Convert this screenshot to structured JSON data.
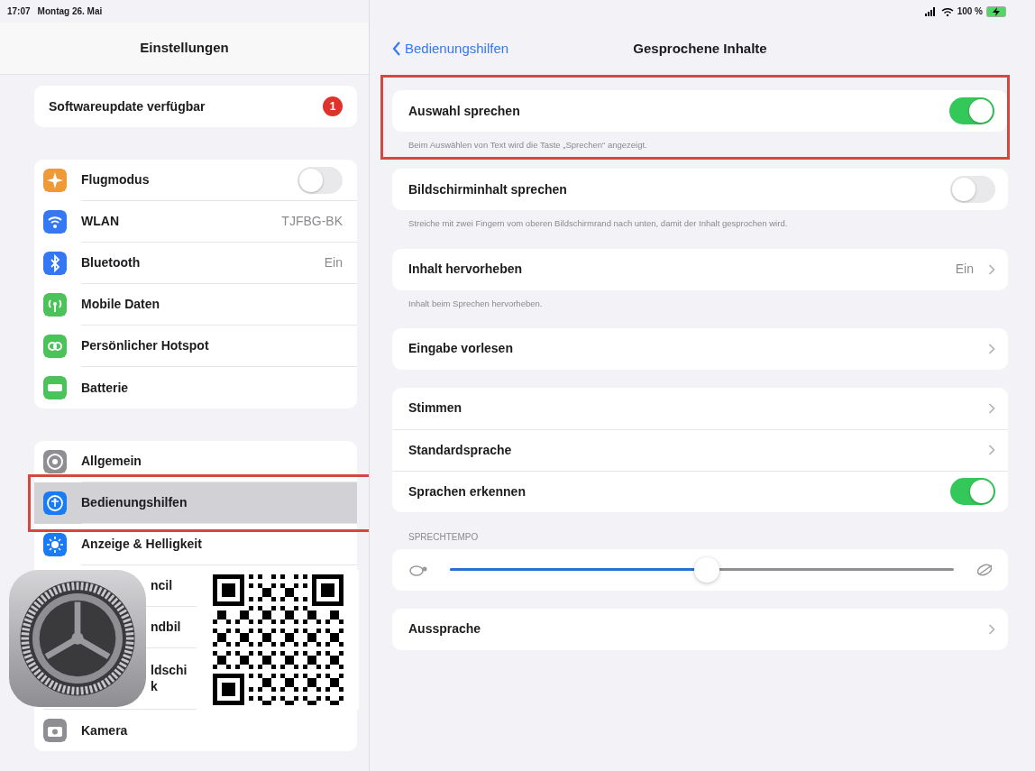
{
  "status_bar": {
    "time": "17:07",
    "date": "Montag 26. Mai",
    "battery": "100 %",
    "charging": true
  },
  "sidebar": {
    "title": "Einstellungen",
    "groups": [
      {
        "items": [
          {
            "kind": "badge",
            "label": "Softwareupdate verfügbar",
            "badge": "1",
            "selected": false,
            "highlighted": false
          }
        ]
      },
      {
        "items": [
          {
            "kind": "toggle",
            "label": "Flugmodus",
            "color": "#f09a37",
            "on": false,
            "selected": false,
            "highlighted": false
          },
          {
            "kind": "value",
            "label": "WLAN",
            "color": "#3478f6",
            "value": "TJFBG-BK",
            "selected": false,
            "highlighted": false
          },
          {
            "kind": "value",
            "label": "Bluetooth",
            "color": "#3478f6",
            "value": "Ein",
            "selected": false,
            "highlighted": false
          },
          {
            "kind": "plain",
            "label": "Mobile Daten",
            "color": "#4cc35a",
            "selected": false,
            "highlighted": false
          },
          {
            "kind": "plain",
            "label": "Persönlicher Hotspot",
            "color": "#4cc35a",
            "selected": false,
            "highlighted": false
          },
          {
            "kind": "plain",
            "label": "Batterie",
            "color": "#4cc35a",
            "selected": false,
            "highlighted": false
          }
        ]
      },
      {
        "items": [
          {
            "kind": "plain",
            "label": "Allgemein",
            "color": "#8e8e93",
            "selected": false,
            "highlighted": false
          },
          {
            "kind": "plain",
            "label": "Bedienungshilfen",
            "color": "#1a7cf5",
            "selected": true,
            "highlighted": true
          },
          {
            "kind": "plain",
            "label": "Anzeige & Helligkeit",
            "color": "#1a7cf5",
            "selected": false,
            "highlighted": false
          },
          {
            "kind": "covered",
            "lines": [
              "ncil"
            ]
          },
          {
            "kind": "covered",
            "lines": [
              "ndbil"
            ]
          },
          {
            "kind": "covered",
            "lines": [
              "ldschi",
              "k"
            ]
          },
          {
            "kind": "plain",
            "label": "Kamera",
            "color": "#8e8e93",
            "selected": false,
            "highlighted": false
          }
        ]
      }
    ]
  },
  "detail": {
    "back": "Bedienungshilfen",
    "title": "Gesprochene Inhalte",
    "groups": [
      {
        "highlighted": true,
        "items": [
          {
            "kind": "toggle",
            "label": "Auswahl sprechen",
            "on": true
          }
        ],
        "footer": "Beim Auswählen von Text wird die Taste „Sprechen“ angezeigt."
      },
      {
        "highlighted": false,
        "items": [
          {
            "kind": "toggle",
            "label": "Bildschirminhalt sprechen",
            "on": false
          }
        ],
        "footer": "Streiche mit zwei Fingern vom oberen Bildschirmrand nach unten, damit der Inhalt gesprochen wird."
      },
      {
        "highlighted": false,
        "items": [
          {
            "kind": "disclosure",
            "label": "Inhalt hervorheben",
            "value": "Ein"
          }
        ],
        "footer": "Inhalt beim Sprechen hervorheben."
      },
      {
        "highlighted": false,
        "items": [
          {
            "kind": "disclosure",
            "label": "Eingabe vorlesen"
          }
        ]
      },
      {
        "highlighted": false,
        "items": [
          {
            "kind": "disclosure",
            "label": "Stimmen"
          },
          {
            "kind": "disclosure",
            "label": "Standardsprache"
          },
          {
            "kind": "toggle",
            "label": "Sprachen erkennen",
            "on": true
          }
        ]
      },
      {
        "highlighted": false,
        "header": "SPRECHTEMPO",
        "items": [
          {
            "kind": "slider",
            "level": 0.51
          }
        ]
      },
      {
        "highlighted": false,
        "items": [
          {
            "kind": "disclosure",
            "label": "Aussprache"
          }
        ]
      }
    ]
  }
}
